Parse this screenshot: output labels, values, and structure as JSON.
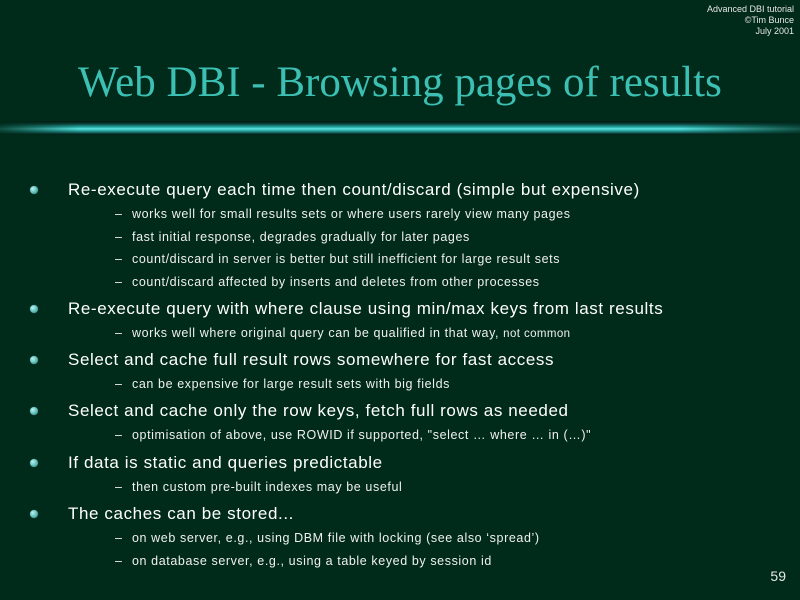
{
  "meta": {
    "line1": "Advanced DBI tutorial",
    "line2": "©Tim Bunce",
    "line3": "July 2001"
  },
  "title": "Web DBI - Browsing pages of results",
  "bullets": [
    {
      "text": "Re-execute query each time then count/discard (simple but expensive)",
      "subs": [
        {
          "text": "works well for small results sets or where users rarely view many pages"
        },
        {
          "text": "fast initial response, degrades gradually for later pages"
        },
        {
          "text": "count/discard in server is better but still inefficient for large result sets"
        },
        {
          "text": "count/discard affected by inserts and deletes from other processes"
        }
      ]
    },
    {
      "text": "Re-execute query with where clause using min/max keys from last results",
      "subs": [
        {
          "text": "works well where original query can be qualified in that way, ",
          "small": "not common"
        }
      ]
    },
    {
      "text": "Select and cache full result rows somewhere for fast access",
      "subs": [
        {
          "text": "can be expensive for large result sets with big fields"
        }
      ]
    },
    {
      "text": "Select and cache only the row keys, fetch full rows as needed",
      "subs": [
        {
          "text": "optimisation of above, use ROWID if supported, \"select … where … in (…)\""
        }
      ]
    },
    {
      "text": "If data is static and queries predictable",
      "subs": [
        {
          "text": "then custom pre-built indexes may be useful"
        }
      ]
    },
    {
      "text": "The caches can be stored...",
      "subs": [
        {
          "text": "on web server, e.g., using DBM file with locking (see also ‘spread’)"
        },
        {
          "text": "on database server, e.g., using a table keyed by session id"
        }
      ]
    }
  ],
  "page_number": "59",
  "colors": {
    "background": "#002a1a",
    "title": "#3cc0b4",
    "bullet_dot": "#69c7c2"
  },
  "icons": {
    "bullet": "filled-circle-bullet-icon",
    "sub_bullet": "en-dash"
  }
}
